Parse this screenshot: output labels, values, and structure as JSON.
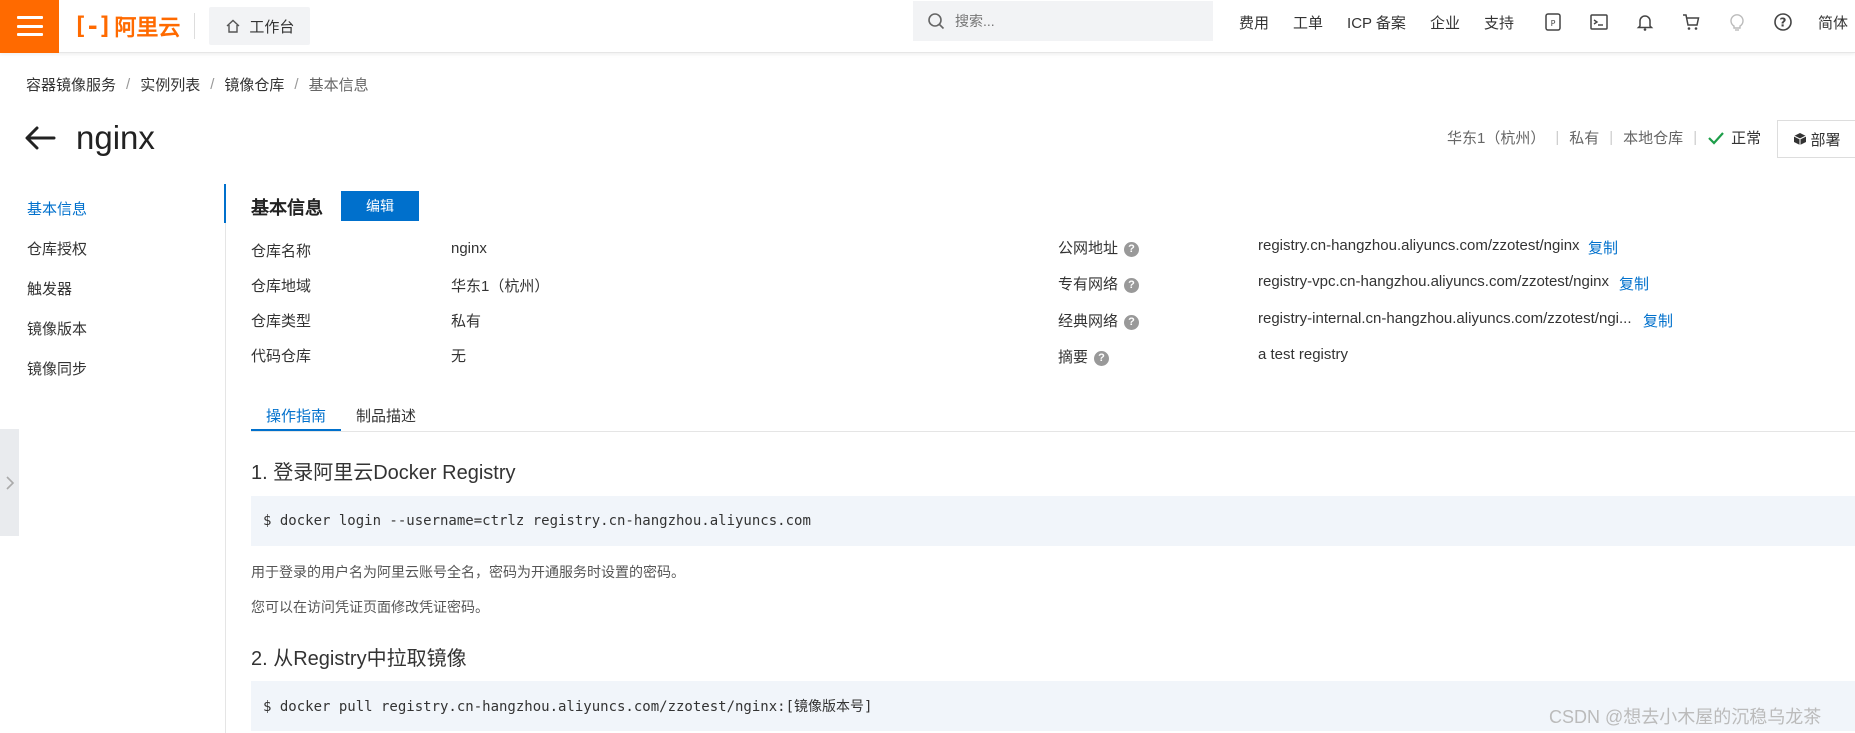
{
  "header": {
    "logo_text": "阿里云",
    "workbench_label": "工作台",
    "search_placeholder": "搜索...",
    "links": [
      "费用",
      "工单",
      "ICP 备案",
      "企业",
      "支持"
    ],
    "language": "简体"
  },
  "breadcrumb": [
    "容器镜像服务",
    "实例列表",
    "镜像仓库",
    "基本信息"
  ],
  "page": {
    "title": "nginx",
    "region": "华东1（杭州）",
    "visibility": "私有",
    "repo_source": "本地仓库",
    "status": "正常",
    "deploy_label": "部署"
  },
  "nav": {
    "items": [
      "基本信息",
      "仓库授权",
      "触发器",
      "镜像版本",
      "镜像同步"
    ],
    "active_index": 0
  },
  "basic_info": {
    "section_title": "基本信息",
    "edit_label": "编辑",
    "left": [
      {
        "label": "仓库名称",
        "value": "nginx"
      },
      {
        "label": "仓库地域",
        "value": "华东1（杭州）"
      },
      {
        "label": "仓库类型",
        "value": "私有"
      },
      {
        "label": "代码仓库",
        "value": "无"
      }
    ],
    "right": [
      {
        "label": "公网地址",
        "value": "registry.cn-hangzhou.aliyuncs.com/zzotest/nginx",
        "copy": "复制"
      },
      {
        "label": "专有网络",
        "value": "registry-vpc.cn-hangzhou.aliyuncs.com/zzotest/nginx",
        "copy": "复制"
      },
      {
        "label": "经典网络",
        "value": "registry-internal.cn-hangzhou.aliyuncs.com/zzotest/ngi...",
        "copy": "复制"
      },
      {
        "label": "摘要",
        "value": "a test registry"
      }
    ]
  },
  "tabs": [
    {
      "label": "操作指南",
      "active": true
    },
    {
      "label": "制品描述",
      "active": false
    }
  ],
  "guide": {
    "step1_title": "1. 登录阿里云Docker Registry",
    "step1_code": "$ docker login --username=ctrlz registry.cn-hangzhou.aliyuncs.com",
    "step1_note1": "用于登录的用户名为阿里云账号全名，密码为开通服务时设置的密码。",
    "step1_note2": "您可以在访问凭证页面修改凭证密码。",
    "step2_title": "2. 从Registry中拉取镜像",
    "step2_code": "$ docker pull registry.cn-hangzhou.aliyuncs.com/zzotest/nginx:[镜像版本号]"
  },
  "watermark": "CSDN @想去小木屋的沉稳乌龙茶",
  "colors": {
    "brand": "#ff6a00",
    "primary": "#0070cc",
    "status_ok": "#1e9e4a",
    "code_bg": "#f1f5fa"
  }
}
